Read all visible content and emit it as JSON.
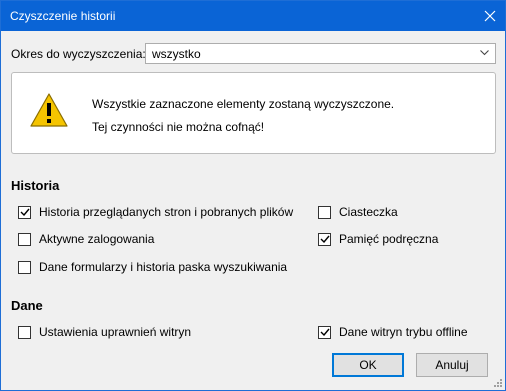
{
  "window": {
    "title": "Czyszczenie historii"
  },
  "range": {
    "label": "Okres do wyczyszczenia:",
    "value": "wszystko"
  },
  "warning": {
    "line1": "Wszystkie zaznaczone elementy zostaną wyczyszczone.",
    "line2": "Tej czynności nie można cofnąć!"
  },
  "history": {
    "heading": "Historia",
    "items": [
      {
        "label": "Historia przeglądanych stron i pobranych plików",
        "checked": true
      },
      {
        "label": "Ciasteczka",
        "checked": false
      },
      {
        "label": "Aktywne zalogowania",
        "checked": false
      },
      {
        "label": "Pamięć podręczna",
        "checked": true
      },
      {
        "label": "Dane formularzy i historia paska wyszukiwania",
        "checked": false
      }
    ]
  },
  "data_section": {
    "heading": "Dane",
    "items": [
      {
        "label": "Ustawienia uprawnień witryn",
        "checked": false
      },
      {
        "label": "Dane witryn trybu offline",
        "checked": true
      }
    ]
  },
  "buttons": {
    "ok": "OK",
    "cancel": "Anuluj"
  },
  "icons": {
    "warning": "warning-triangle-icon",
    "close": "close-icon",
    "dropdown": "chevron-down-icon",
    "check": "checkmark-icon"
  },
  "colors": {
    "titlebar": "#0a64d6",
    "warning": "#f5c400",
    "accent": "#0078d7"
  }
}
